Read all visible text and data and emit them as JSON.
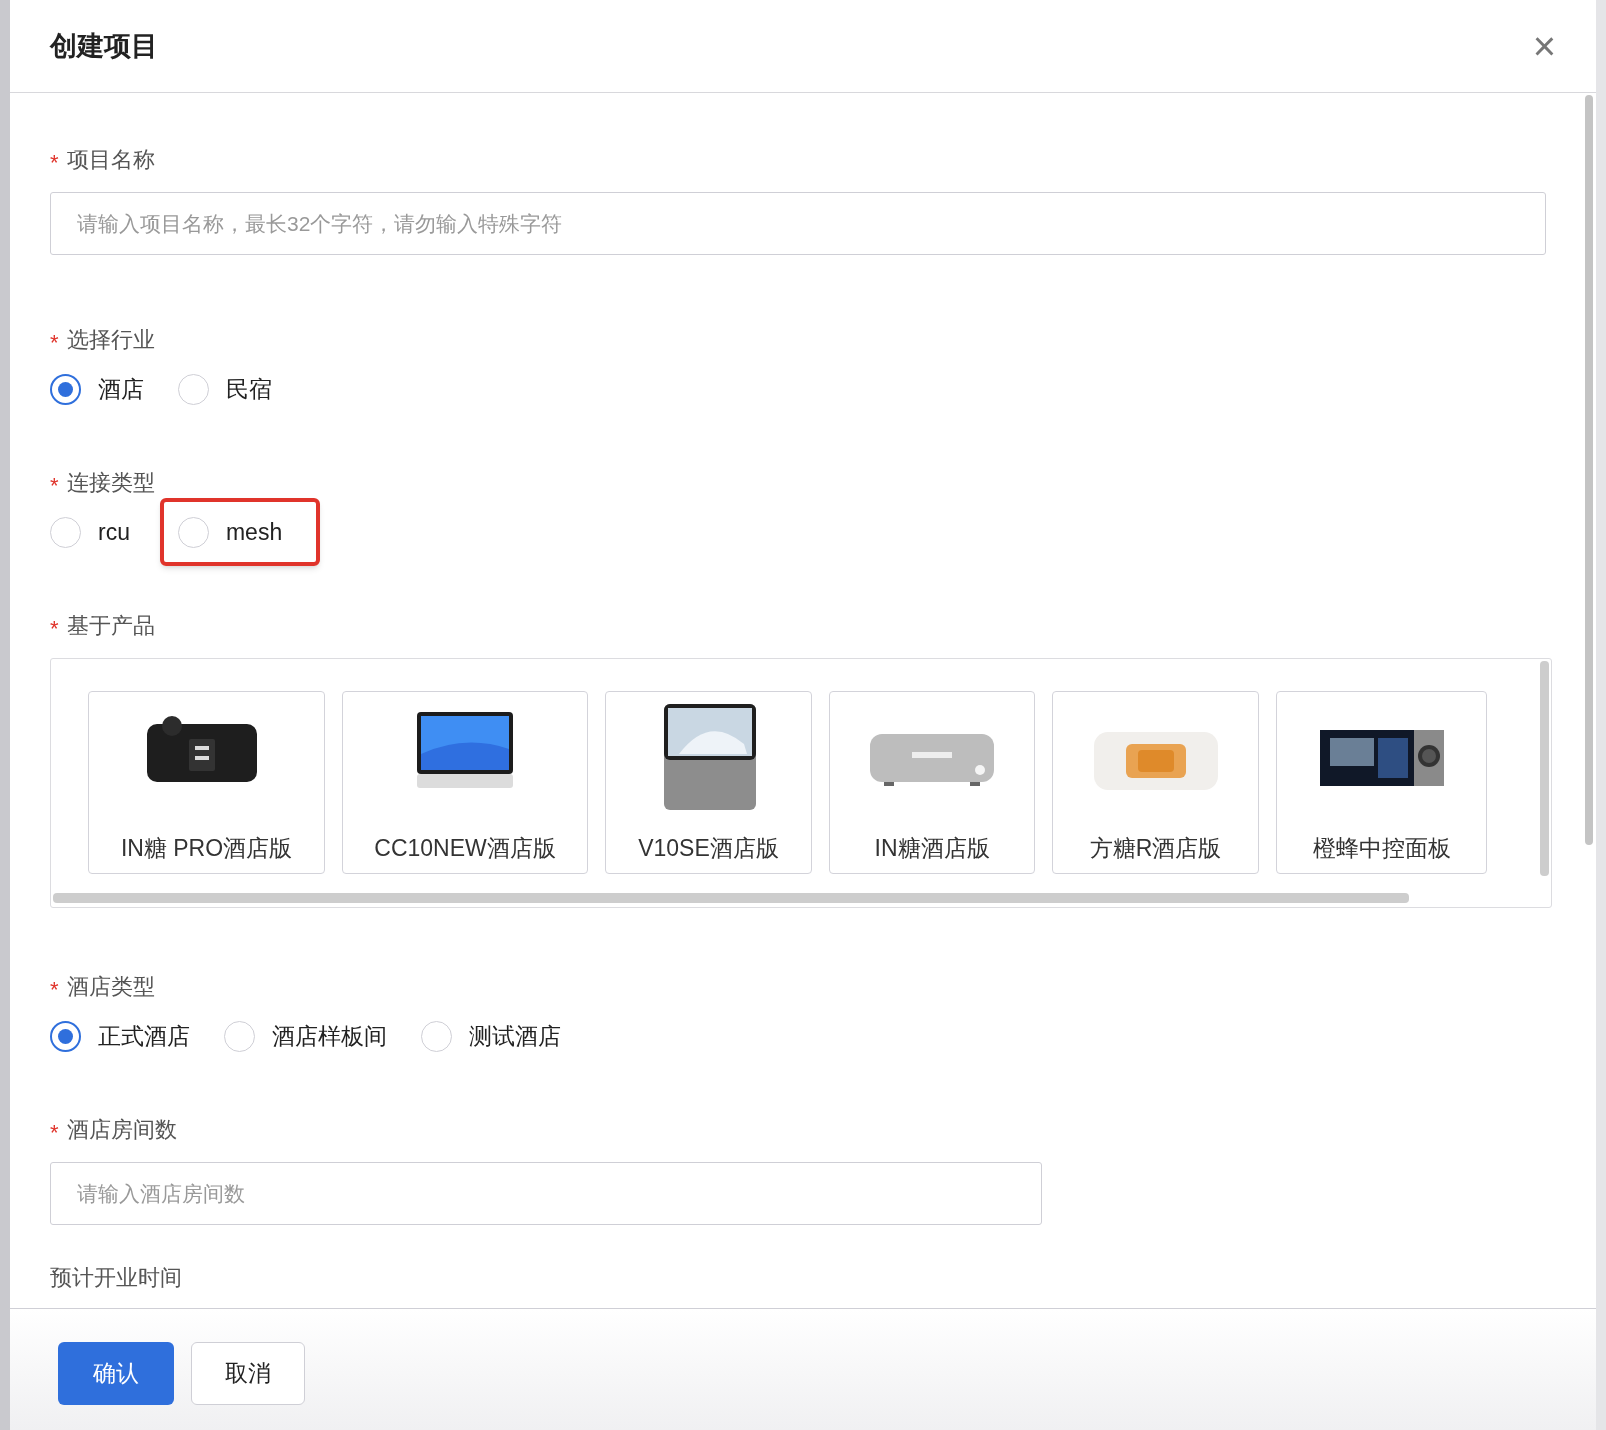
{
  "dialog": {
    "title": "创建项目",
    "close": "×"
  },
  "fields": [
    {
      "kind": "input",
      "label": "项目名称",
      "required_mark": "*",
      "placeholder": "请输入项目名称，最长32个字符，请勿输入特殊字符",
      "wide": true
    },
    {
      "kind": "radio",
      "label": "选择行业",
      "required_mark": "*",
      "options": [
        {
          "label": "酒店",
          "selected": true,
          "highlighted": false
        },
        {
          "label": "民宿",
          "selected": false,
          "highlighted": false
        }
      ]
    },
    {
      "kind": "radio",
      "label": "连接类型",
      "required_mark": "*",
      "options": [
        {
          "label": "rcu",
          "selected": false,
          "highlighted": false
        },
        {
          "label": "mesh",
          "selected": false,
          "highlighted": true
        }
      ]
    },
    {
      "kind": "products",
      "label": "基于产品",
      "required_mark": "*",
      "products": [
        {
          "name": "IN糖 PRO酒店版",
          "kind": "picture"
        },
        {
          "name": "CC10NEW酒店版",
          "kind": "picture"
        },
        {
          "name": "V10SE酒店版",
          "kind": "picture"
        },
        {
          "name": "IN糖酒店版",
          "kind": "picture"
        },
        {
          "name": "方糖R酒店版",
          "kind": "picture"
        },
        {
          "name": "橙蜂中控面板",
          "kind": "picture"
        }
      ]
    },
    {
      "kind": "radio",
      "label": "酒店类型",
      "required_mark": "*",
      "options": [
        {
          "label": "正式酒店",
          "selected": true,
          "highlighted": false
        },
        {
          "label": "酒店样板间",
          "selected": false,
          "highlighted": false
        },
        {
          "label": "测试酒店",
          "selected": false,
          "highlighted": false
        }
      ]
    },
    {
      "kind": "input",
      "label": "酒店房间数",
      "required_mark": "*",
      "placeholder": "请输入酒店房间数",
      "wide": false
    },
    {
      "kind": "cut",
      "label": "预计开业时间"
    }
  ],
  "buttons": [
    {
      "label": "确认",
      "primary": true
    },
    {
      "label": "取消",
      "primary": false
    }
  ]
}
